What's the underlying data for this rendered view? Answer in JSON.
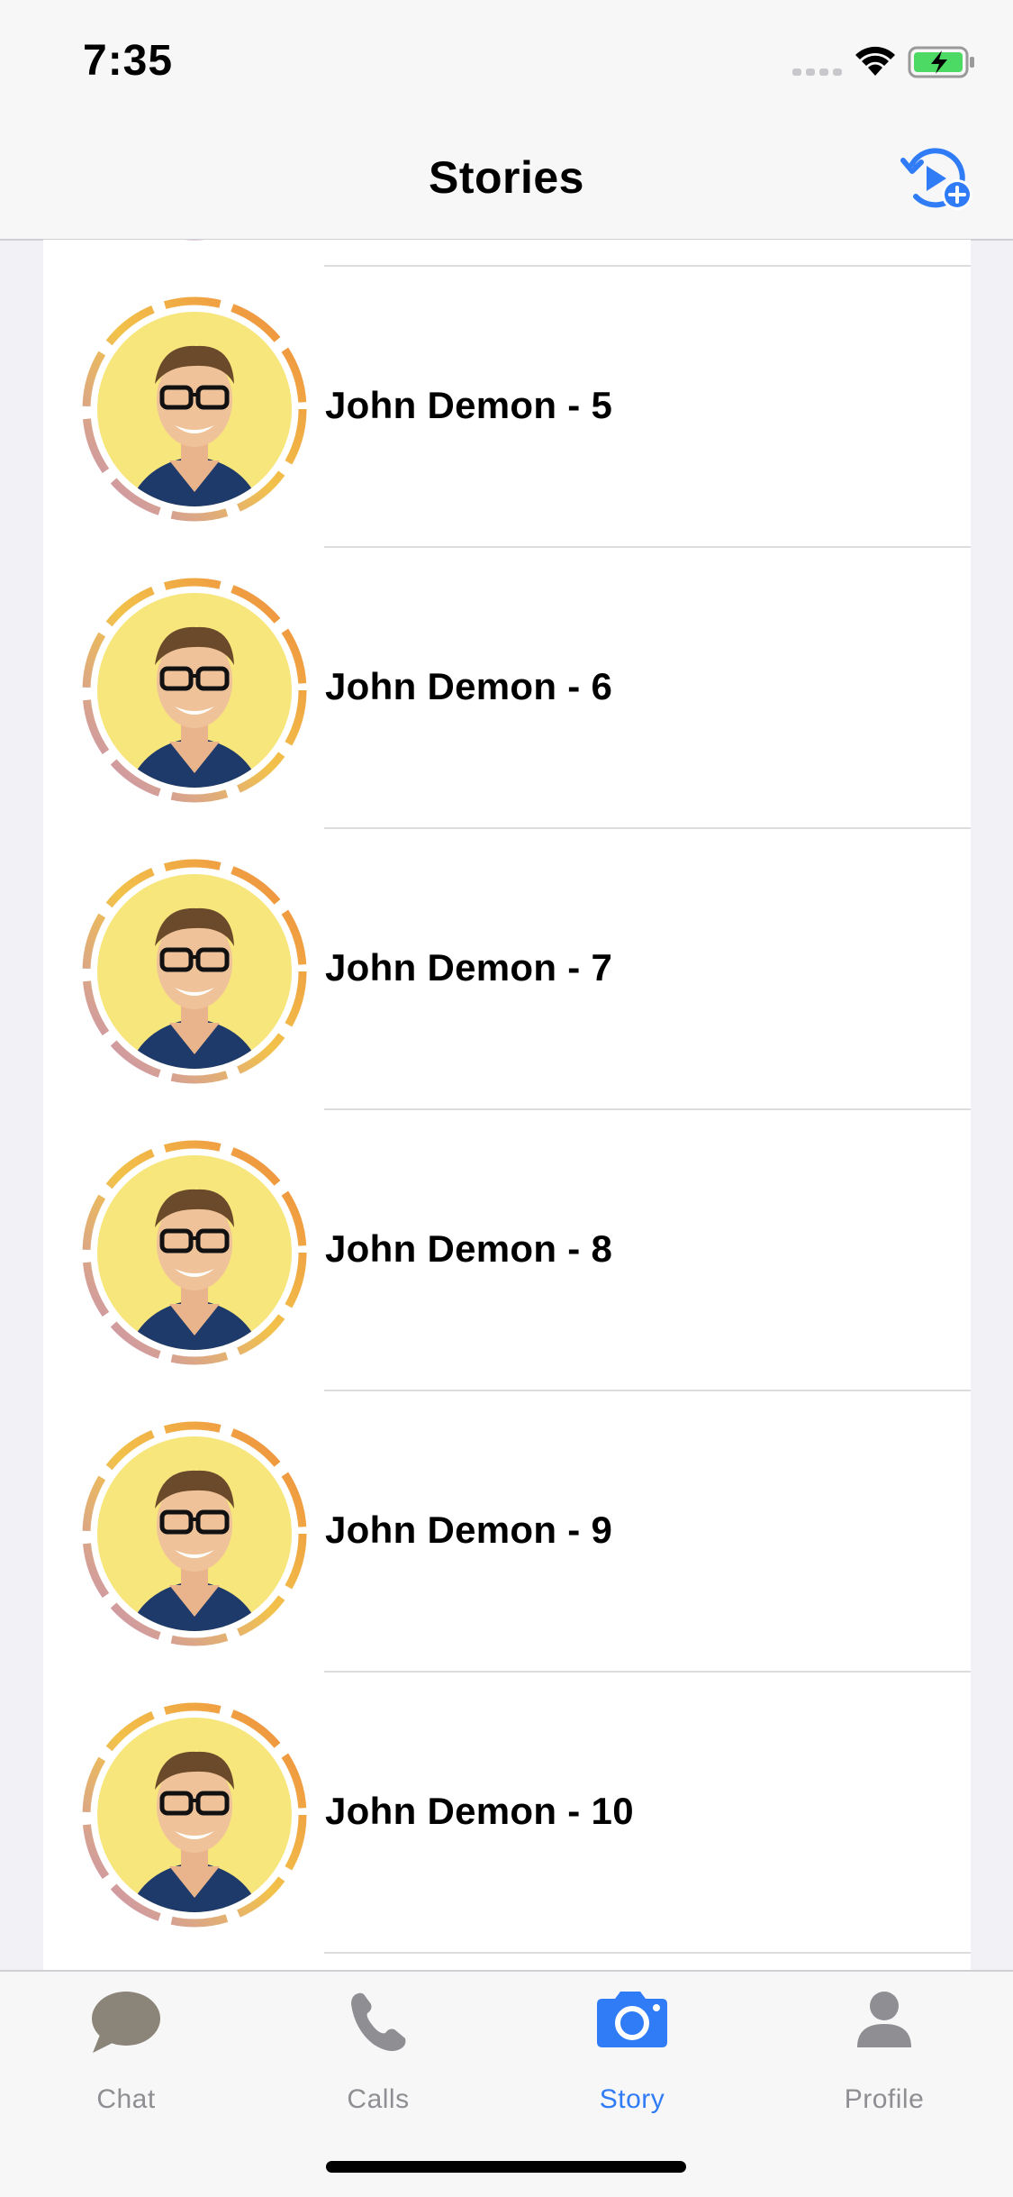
{
  "status_bar": {
    "time": "7:35"
  },
  "nav": {
    "title": "Stories"
  },
  "stories": [
    {
      "name": "John Demon - 5"
    },
    {
      "name": "John Demon - 6"
    },
    {
      "name": "John Demon - 7"
    },
    {
      "name": "John Demon - 8"
    },
    {
      "name": "John Demon - 9"
    },
    {
      "name": "John Demon - 10"
    }
  ],
  "tabs": [
    {
      "label": "Chat",
      "icon": "chat-bubble-icon",
      "active": false
    },
    {
      "label": "Calls",
      "icon": "phone-icon",
      "active": false
    },
    {
      "label": "Story",
      "icon": "camera-icon",
      "active": true
    },
    {
      "label": "Profile",
      "icon": "person-icon",
      "active": false
    }
  ],
  "colors": {
    "accent": "#2f7cf6",
    "ring_orange": "#ee8a3c",
    "ring_yellow": "#f2c24a",
    "ring_purple": "#c48cc0",
    "avatar_bg": "#f7e67c"
  }
}
